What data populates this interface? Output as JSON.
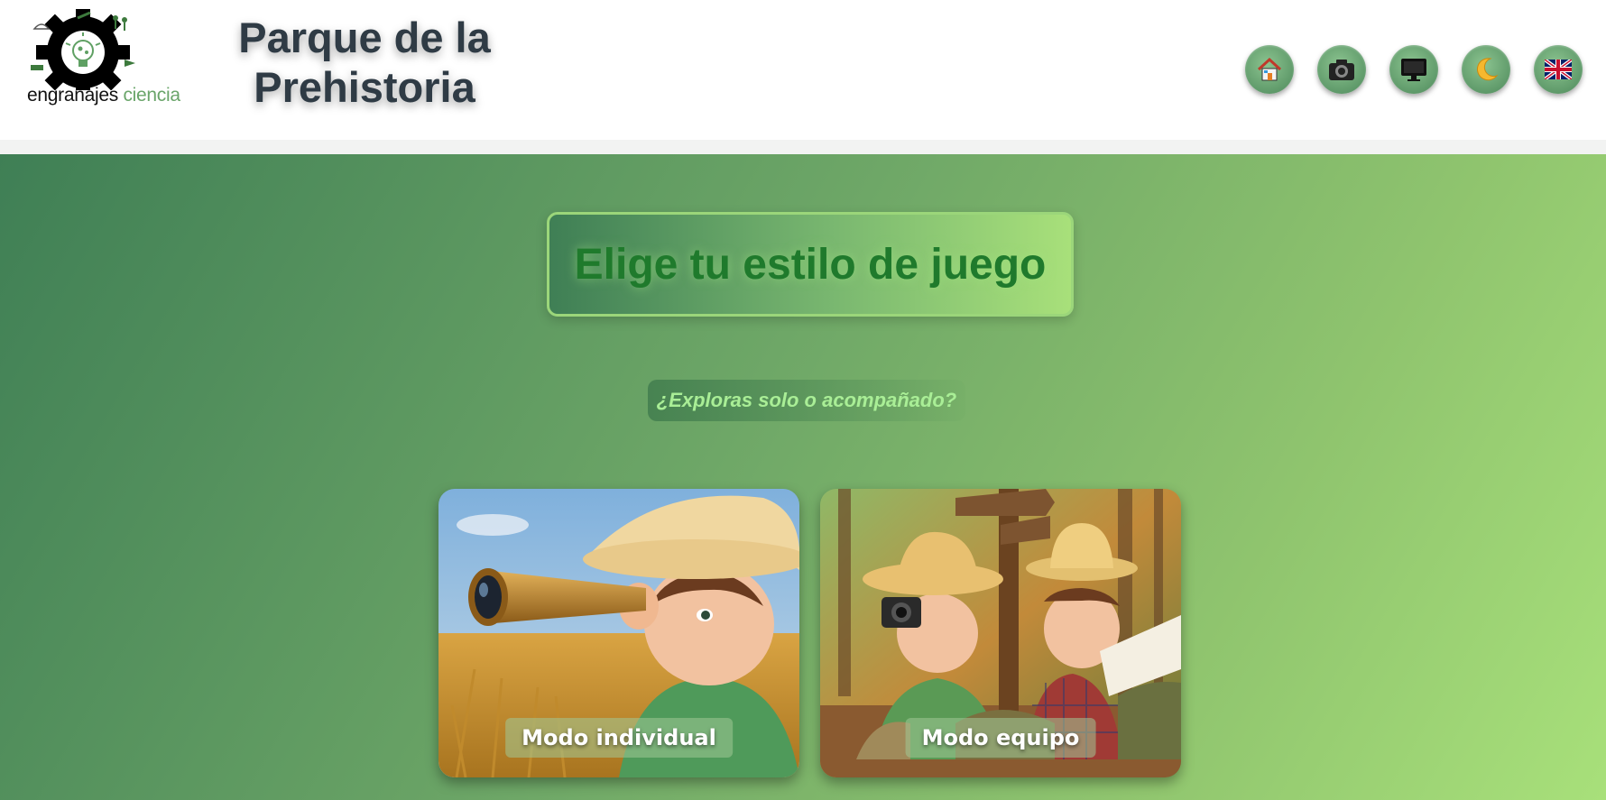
{
  "header": {
    "logo": {
      "word1": "engranajes",
      "word2": "ciencia"
    },
    "title": "Parque de la Prehistoria",
    "nav": [
      {
        "name": "home",
        "icon": "house-icon"
      },
      {
        "name": "gallery",
        "icon": "camera-icon"
      },
      {
        "name": "screen",
        "icon": "monitor-icon"
      },
      {
        "name": "dark-mode",
        "icon": "moon-icon"
      },
      {
        "name": "language",
        "icon": "uk-flag-icon"
      }
    ]
  },
  "main": {
    "heading": "Elige tu estilo de juego",
    "subtitle": "¿Exploras solo o acompañado?",
    "cards": [
      {
        "label": "Modo individual",
        "image": "child-explorer-with-telescope"
      },
      {
        "label": "Modo equipo",
        "image": "two-child-explorers-in-forest"
      }
    ]
  },
  "colors": {
    "heading": "#1f7a2c",
    "subtitle": "#a9ee96",
    "title": "#2f3b45",
    "gradient_start": "#3f7f55",
    "gradient_end": "#a8e07a"
  }
}
